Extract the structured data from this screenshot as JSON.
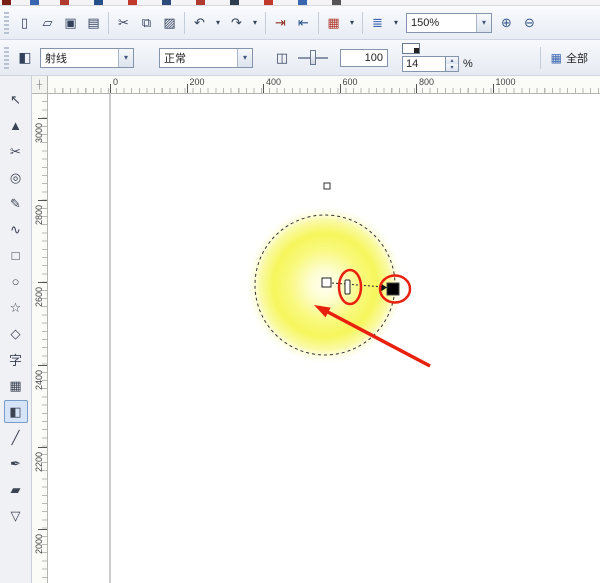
{
  "colors": {
    "annotation_red": "#e8200e",
    "glow_yellow": "#f6f65c",
    "active_tool_bg": "#d6e4f8"
  },
  "icons": {
    "chevron_down": "▾",
    "spinner_up": "▴",
    "spinner_down": "▾",
    "grid": "▦",
    "fill_edit": "◧",
    "midpoint": "◫",
    "origin": "┼"
  },
  "toolbar": {
    "zoom_value": "150%",
    "buttons": [
      {
        "name": "new-document",
        "glyph": "▯"
      },
      {
        "name": "open",
        "glyph": "▱"
      },
      {
        "name": "save",
        "glyph": "▣"
      },
      {
        "name": "print",
        "glyph": "▤"
      },
      {
        "separator": true
      },
      {
        "name": "cut",
        "glyph": "✂"
      },
      {
        "name": "copy",
        "glyph": "⧉"
      },
      {
        "name": "paste",
        "glyph": "▨"
      },
      {
        "separator": true
      },
      {
        "name": "undo",
        "glyph": "↶"
      },
      {
        "name": "undo-dropdown",
        "glyph": "▾",
        "narrow": true
      },
      {
        "name": "redo",
        "glyph": "↷"
      },
      {
        "name": "redo-dropdown",
        "glyph": "▾",
        "narrow": true
      },
      {
        "separator": true
      },
      {
        "name": "import",
        "glyph": "⇥",
        "color": "#8c2f1e"
      },
      {
        "name": "export",
        "glyph": "⇤",
        "color": "#27518a"
      },
      {
        "separator": true
      },
      {
        "name": "application-launcher",
        "glyph": "▦",
        "color": "#b03a2e"
      },
      {
        "name": "application-launcher-dropdown",
        "glyph": "▾",
        "narrow": true
      },
      {
        "separator": true
      },
      {
        "name": "snap-options",
        "glyph": "≣",
        "color": "#3a66b0"
      },
      {
        "name": "snap-options-dropdown",
        "glyph": "▾",
        "narrow": true
      }
    ],
    "right_buttons": [
      {
        "name": "zoom-in",
        "glyph": "⊕",
        "color": "#3a5a8c"
      },
      {
        "name": "zoom-out",
        "glyph": "⊖",
        "color": "#3a5a8c"
      }
    ]
  },
  "propbar": {
    "fill_type_value": "射线",
    "paint_mode_value": "正常",
    "midpoint_value": "100",
    "edge_pad_value": "14",
    "percent_label": "%",
    "all_button_label": "全部"
  },
  "rulers": {
    "horizontal": [
      "0",
      "200",
      "400",
      "600",
      "800",
      "1000"
    ],
    "vertical": [
      "3000",
      "2800",
      "2600",
      "2400",
      "2200",
      "2000"
    ]
  },
  "toolbox": {
    "tools": [
      {
        "name": "pick",
        "glyph": "↖"
      },
      {
        "name": "shape",
        "glyph": "▲"
      },
      {
        "name": "crop",
        "glyph": "✂"
      },
      {
        "name": "zoom",
        "glyph": "◎"
      },
      {
        "name": "freehand",
        "glyph": "✎"
      },
      {
        "name": "smart-fill",
        "glyph": "∿"
      },
      {
        "name": "rectangle",
        "glyph": "□"
      },
      {
        "name": "ellipse",
        "glyph": "○"
      },
      {
        "name": "polygon",
        "glyph": "☆"
      },
      {
        "name": "basic-shapes",
        "glyph": "◇"
      },
      {
        "name": "text",
        "glyph": "字"
      },
      {
        "name": "table",
        "glyph": "▦"
      },
      {
        "name": "interactive-fill",
        "glyph": "◧",
        "active": true
      },
      {
        "name": "eyedropper",
        "glyph": "╱"
      },
      {
        "name": "outline-pen",
        "glyph": "✒"
      },
      {
        "name": "fill",
        "glyph": "▰"
      },
      {
        "name": "transparency",
        "glyph": "▽"
      }
    ]
  }
}
